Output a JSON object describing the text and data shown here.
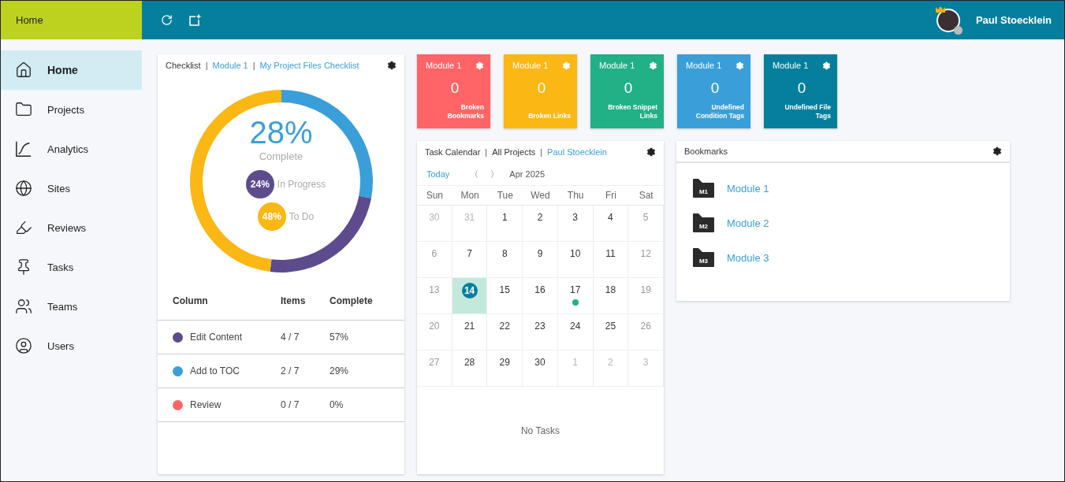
{
  "topbar": {
    "title": "Home",
    "user": {
      "name": "Paul Stoecklein"
    }
  },
  "sidebar": {
    "items": [
      {
        "label": "Home",
        "selected": true
      },
      {
        "label": "Projects",
        "selected": false
      },
      {
        "label": "Analytics",
        "selected": false
      },
      {
        "label": "Sites",
        "selected": false
      },
      {
        "label": "Reviews",
        "selected": false
      },
      {
        "label": "Tasks",
        "selected": false
      },
      {
        "label": "Teams",
        "selected": false
      },
      {
        "label": "Users",
        "selected": false
      }
    ]
  },
  "checklist": {
    "separator": "|",
    "title": [
      {
        "text": "Checklist",
        "link": false
      },
      {
        "text": "Module 1",
        "link": true
      },
      {
        "text": "My Project Files Checklist",
        "link": true
      }
    ],
    "summary": {
      "value": "28%",
      "color": "#3a9fd8"
    },
    "legend": [
      {
        "value": "24%",
        "color": "#5d4b8d"
      },
      {
        "value": "48%",
        "color": "#fbb714"
      }
    ],
    "chart_data": {
      "type": "donut",
      "categories": [
        "Complete",
        "In Progress",
        "To Do"
      ],
      "series": [
        {
          "values": [
            28,
            24,
            48
          ]
        }
      ]
    },
    "table": {
      "columns": [
        "Column",
        "Items",
        "Complete"
      ],
      "rows": [
        {
          "name": "Edit Content",
          "items": "4 / 7",
          "complete": "57%",
          "color": "#5d4b8d"
        },
        {
          "name": "Add to TOC",
          "items": "2 / 7",
          "complete": "29%",
          "color": "#3a9fd8"
        },
        {
          "name": "Review",
          "items": "0 / 7",
          "complete": "0%",
          "color": "#ff6566"
        }
      ]
    }
  },
  "tiles": [
    {
      "title": "Module 1",
      "value": "0",
      "label": "Broken Bookmarks",
      "color": "#ff6566"
    },
    {
      "title": "Module 1",
      "value": "0",
      "label": "Broken Links",
      "color": "#fbb714"
    },
    {
      "title": "Module 1",
      "value": "0",
      "label": "Broken Snippet Links",
      "color": "#22b086"
    },
    {
      "title": "Module 1",
      "value": "0",
      "label": "Undefined Condition Tags",
      "color": "#3a9fd8"
    },
    {
      "title": "Module 1",
      "value": "0",
      "label": "Undefined File Tags",
      "color": "#067f9e"
    }
  ],
  "calendar": {
    "separator": "|",
    "title": [
      {
        "text": "Task Calendar",
        "link": false
      },
      {
        "text": "All Projects",
        "link": false
      },
      {
        "text": "Paul Stoecklein",
        "link": true
      }
    ],
    "today_button": "Today",
    "prev": "〈",
    "next": "〉",
    "month": "Apr 2025",
    "weekdays": [
      "Sun",
      "Mon",
      "Tue",
      "Wed",
      "Thu",
      "Fri",
      "Sat"
    ],
    "days": [
      {
        "day": "30",
        "outside": true,
        "weekend": true,
        "today": false,
        "task": false
      },
      {
        "day": "31",
        "outside": true,
        "weekend": false,
        "today": false,
        "task": false
      },
      {
        "day": "1",
        "outside": false,
        "weekend": false,
        "today": false,
        "task": false
      },
      {
        "day": "2",
        "outside": false,
        "weekend": false,
        "today": false,
        "task": false
      },
      {
        "day": "3",
        "outside": false,
        "weekend": false,
        "today": false,
        "task": false
      },
      {
        "day": "4",
        "outside": false,
        "weekend": false,
        "today": false,
        "task": false
      },
      {
        "day": "5",
        "outside": false,
        "weekend": true,
        "today": false,
        "task": false
      },
      {
        "day": "6",
        "outside": false,
        "weekend": true,
        "today": false,
        "task": false
      },
      {
        "day": "7",
        "outside": false,
        "weekend": false,
        "today": false,
        "task": false
      },
      {
        "day": "8",
        "outside": false,
        "weekend": false,
        "today": false,
        "task": false
      },
      {
        "day": "9",
        "outside": false,
        "weekend": false,
        "today": false,
        "task": false
      },
      {
        "day": "10",
        "outside": false,
        "weekend": false,
        "today": false,
        "task": false
      },
      {
        "day": "11",
        "outside": false,
        "weekend": false,
        "today": false,
        "task": false
      },
      {
        "day": "12",
        "outside": false,
        "weekend": true,
        "today": false,
        "task": false
      },
      {
        "day": "13",
        "outside": false,
        "weekend": true,
        "today": false,
        "task": false
      },
      {
        "day": "14",
        "outside": false,
        "weekend": false,
        "today": true,
        "task": false
      },
      {
        "day": "15",
        "outside": false,
        "weekend": false,
        "today": false,
        "task": false
      },
      {
        "day": "16",
        "outside": false,
        "weekend": false,
        "today": false,
        "task": false
      },
      {
        "day": "17",
        "outside": false,
        "weekend": false,
        "today": false,
        "task": true
      },
      {
        "day": "18",
        "outside": false,
        "weekend": false,
        "today": false,
        "task": false
      },
      {
        "day": "19",
        "outside": false,
        "weekend": true,
        "today": false,
        "task": false
      },
      {
        "day": "20",
        "outside": false,
        "weekend": true,
        "today": false,
        "task": false
      },
      {
        "day": "21",
        "outside": false,
        "weekend": false,
        "today": false,
        "task": false
      },
      {
        "day": "22",
        "outside": false,
        "weekend": false,
        "today": false,
        "task": false
      },
      {
        "day": "23",
        "outside": false,
        "weekend": false,
        "today": false,
        "task": false
      },
      {
        "day": "24",
        "outside": false,
        "weekend": false,
        "today": false,
        "task": false
      },
      {
        "day": "25",
        "outside": false,
        "weekend": false,
        "today": false,
        "task": false
      },
      {
        "day": "26",
        "outside": false,
        "weekend": true,
        "today": false,
        "task": false
      },
      {
        "day": "27",
        "outside": false,
        "weekend": true,
        "today": false,
        "task": false
      },
      {
        "day": "28",
        "outside": false,
        "weekend": false,
        "today": false,
        "task": false
      },
      {
        "day": "29",
        "outside": false,
        "weekend": false,
        "today": false,
        "task": false
      },
      {
        "day": "30",
        "outside": false,
        "weekend": false,
        "today": false,
        "task": false
      },
      {
        "day": "1",
        "outside": true,
        "weekend": false,
        "today": false,
        "task": false
      },
      {
        "day": "2",
        "outside": true,
        "weekend": false,
        "today": false,
        "task": false
      },
      {
        "day": "3",
        "outside": true,
        "weekend": true,
        "today": false,
        "task": false
      }
    ],
    "empty": "No Tasks"
  },
  "bookmarks": {
    "title": "Bookmarks",
    "items": [
      {
        "badge": "M1",
        "label": "Module 1"
      },
      {
        "badge": "M2",
        "label": "Module 2"
      },
      {
        "badge": "M3",
        "label": "Module 3"
      }
    ]
  }
}
